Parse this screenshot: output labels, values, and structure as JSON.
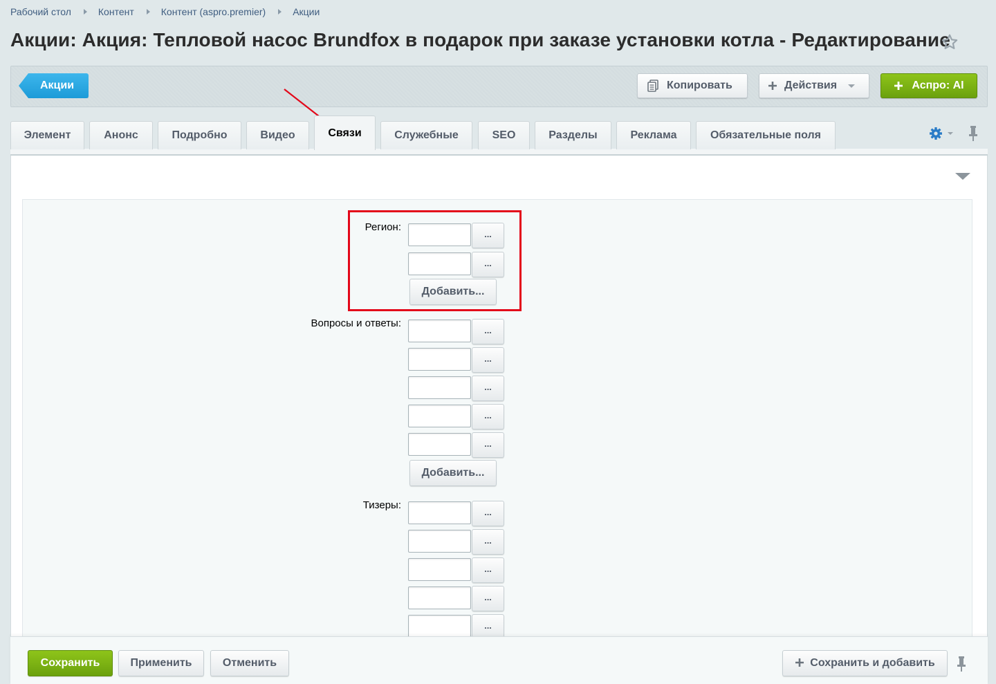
{
  "breadcrumbs": [
    "Рабочий стол",
    "Контент",
    "Контент (aspro.premier)",
    "Акции"
  ],
  "page": {
    "title": "Акции: Акция: Тепловой насос Brundfox в подарок при заказе установки котла - Редактирование"
  },
  "toolbar": {
    "back_label": "Акции",
    "copy_label": "Копировать",
    "actions_label": "Действия",
    "ai_label": "Аспро: AI"
  },
  "tabs": [
    {
      "label": "Элемент",
      "active": false
    },
    {
      "label": "Анонс",
      "active": false
    },
    {
      "label": "Подробно",
      "active": false
    },
    {
      "label": "Видео",
      "active": false
    },
    {
      "label": "Связи",
      "active": true
    },
    {
      "label": "Служебные",
      "active": false
    },
    {
      "label": "SEO",
      "active": false
    },
    {
      "label": "Разделы",
      "active": false
    },
    {
      "label": "Реклама",
      "active": false
    },
    {
      "label": "Обязательные поля",
      "active": false
    }
  ],
  "form": {
    "region": {
      "label": "Регион:",
      "dots_label": "...",
      "add_label": "Добавить..."
    },
    "faq": {
      "label": "Вопросы и ответы:",
      "dots_label": "...",
      "add_label": "Добавить..."
    },
    "teasers": {
      "label": "Тизеры:",
      "dots_label": "..."
    }
  },
  "footer": {
    "save_label": "Сохранить",
    "apply_label": "Применить",
    "cancel_label": "Отменить",
    "save_add_label": "Сохранить и добавить"
  },
  "colors": {
    "accent_blue": "#1d9bd8",
    "accent_green": "#7cb212",
    "annotation_red": "#e3081a"
  }
}
